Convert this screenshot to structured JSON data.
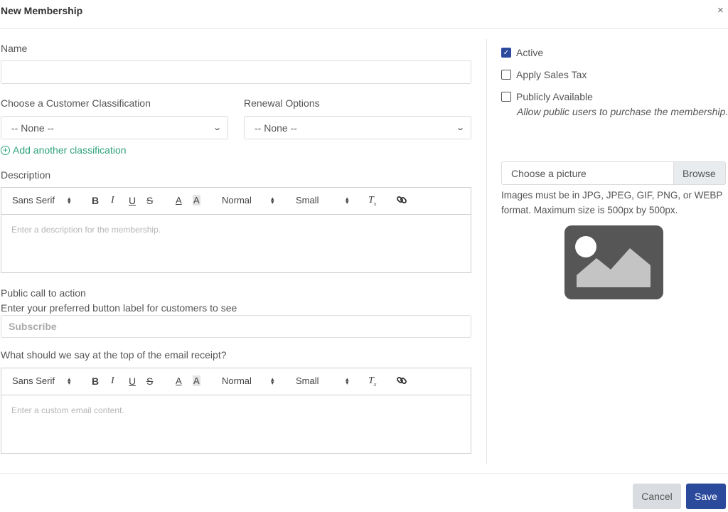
{
  "dialog": {
    "title": "New Membership",
    "close": "×"
  },
  "form": {
    "name_label": "Name",
    "name_value": "",
    "classification_label": "Choose a Customer Classification",
    "classification_value": "-- None --",
    "renewal_label": "Renewal Options",
    "renewal_value": "-- None --",
    "add_classification": "Add another classification",
    "description_label": "Description",
    "description_placeholder": "Enter a description for the membership.",
    "cta_label": "Public call to action",
    "cta_sublabel": "Enter your preferred button label for customers to see",
    "cta_placeholder": "Subscribe",
    "email_label": "What should we say at the top of the email receipt?",
    "email_placeholder": "Enter a custom email content."
  },
  "toolbar": {
    "font": "Sans Serif",
    "bold": "B",
    "italic": "I",
    "underline": "U",
    "strike": "S",
    "color": "A",
    "background": "A",
    "heading": "Normal",
    "size": "Small",
    "clear": "T",
    "clear_sub": "x"
  },
  "options": {
    "active": {
      "label": "Active",
      "checked": true
    },
    "sales_tax": {
      "label": "Apply Sales Tax",
      "checked": false
    },
    "public": {
      "label": "Publicly Available",
      "checked": false
    },
    "public_note": "Allow public users to purchase the membership."
  },
  "picture": {
    "placeholder": "Choose a picture",
    "browse": "Browse",
    "help": "Images must be in JPG, JPEG, GIF, PNG, or WEBP format. Maximum size is 500px by 500px."
  },
  "footer": {
    "cancel": "Cancel",
    "save": "Save"
  },
  "colors": {
    "accent": "#2c4a9c",
    "link": "#2fa37a",
    "placeholder_bg": "#565656"
  }
}
